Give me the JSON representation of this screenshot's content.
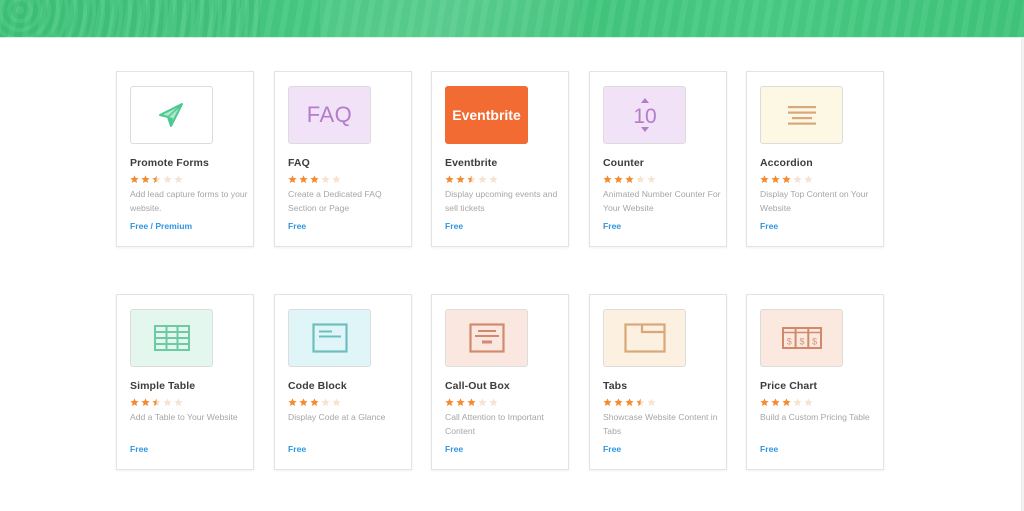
{
  "header": {
    "banner": "green-hero-banner"
  },
  "colors": {
    "banner_green": "#43c77f",
    "star_filled": "#f58a2e",
    "star_empty": "#f7e3d2",
    "price_blue": "#2d95e3",
    "title_text": "#3c3c3c",
    "desc_text": "#a6a6a6"
  },
  "apps": [
    {
      "title": "Promote Forms",
      "rating": 2.5,
      "description": "Add lead capture forms to your website.",
      "price": "Free / Premium",
      "icon": "paper-plane-icon",
      "thumb_bg": "#ffffff",
      "icon_color": "#4cc98d"
    },
    {
      "title": "FAQ",
      "rating": 3,
      "description": "Create a Dedicated FAQ Section or Page",
      "price": "Free",
      "icon": "faq-text-icon",
      "icon_text": "FAQ",
      "thumb_bg": "#f1e2f7",
      "icon_color": "#b57ccc"
    },
    {
      "title": "Eventbrite",
      "rating": 2.5,
      "description": "Display upcoming events and sell tickets",
      "price": "Free",
      "icon": "eventbrite-logo",
      "icon_text": "Eventbrite",
      "thumb_bg": "#f26b32",
      "icon_color": "#ffffff"
    },
    {
      "title": "Counter",
      "rating": 3,
      "description": "Animated Number Counter For Your Website",
      "price": "Free",
      "icon": "counter-icon",
      "icon_text": "10",
      "thumb_bg": "#f1e2f7",
      "icon_color": "#b57ccc"
    },
    {
      "title": "Accordion",
      "rating": 3,
      "description": "Display Top Content on Your Website",
      "price": "Free",
      "icon": "accordion-lines-icon",
      "thumb_bg": "#fcf8e3",
      "icon_color": "#d8a87c"
    },
    {
      "title": "Simple Table",
      "rating": 2.5,
      "description": "Add a Table to Your Website",
      "price": "Free",
      "icon": "table-grid-icon",
      "thumb_bg": "#e3f7ee",
      "icon_color": "#6ccaa5"
    },
    {
      "title": "Code Block",
      "rating": 3,
      "description": "Display Code at a Glance",
      "price": "Free",
      "icon": "code-block-icon",
      "thumb_bg": "#e0f5f8",
      "icon_color": "#6cbfbd"
    },
    {
      "title": "Call-Out Box",
      "rating": 3,
      "description": "Call Attention to Important Content",
      "price": "Free",
      "icon": "callout-box-icon",
      "thumb_bg": "#fae7df",
      "icon_color": "#d38a6c"
    },
    {
      "title": "Tabs",
      "rating": 3.5,
      "description": "Showcase Website Content in Tabs",
      "price": "Free",
      "icon": "tabs-folder-icon",
      "thumb_bg": "#fcf0e0",
      "icon_color": "#d9a878"
    },
    {
      "title": "Price Chart",
      "rating": 3,
      "description": "Build a Custom Pricing Table",
      "price": "Free",
      "icon": "price-chart-icon",
      "icon_text": "$",
      "thumb_bg": "#fbe8df",
      "icon_color": "#d08a6a"
    }
  ]
}
